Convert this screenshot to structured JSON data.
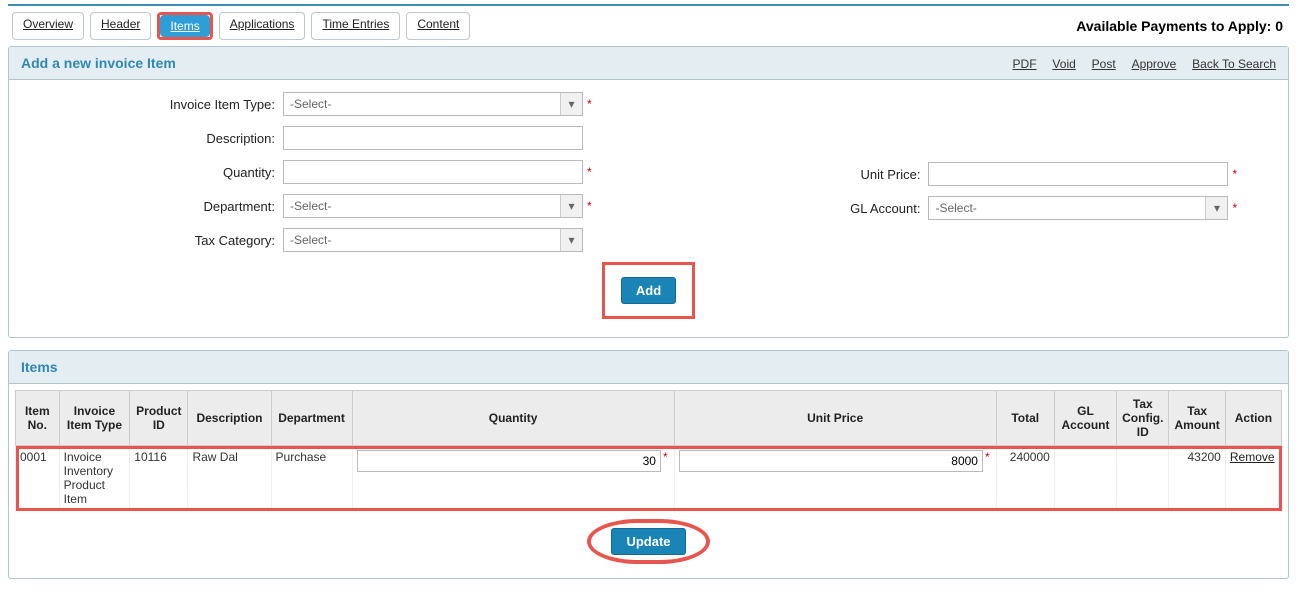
{
  "availablePayments": "Available Payments to Apply: 0",
  "tabs": {
    "overview": "Overview",
    "header": "Header",
    "items": "Items",
    "applications": "Applications",
    "timeEntries": "Time Entries",
    "content": "Content"
  },
  "addPanel": {
    "title": "Add a new invoice Item",
    "actions": {
      "pdf": "PDF",
      "void": "Void",
      "post": "Post",
      "approve": "Approve",
      "back": "Back To Search"
    },
    "labels": {
      "invoiceItemType": "Invoice Item Type:",
      "description": "Description:",
      "quantity": "Quantity:",
      "department": "Department:",
      "taxCategory": "Tax Category:",
      "unitPrice": "Unit Price:",
      "glAccount": "GL Account:"
    },
    "selectPlaceholder": "-Select-",
    "addLabel": "Add"
  },
  "itemsPanel": {
    "title": "Items",
    "headers": {
      "itemNo": "Item No.",
      "invoiceItemType": "Invoice Item Type",
      "productId": "Product ID",
      "description": "Description",
      "department": "Department",
      "quantity": "Quantity",
      "unitPrice": "Unit Price",
      "total": "Total",
      "glAccount": "GL Account",
      "taxConfigId": "Tax Config. ID",
      "taxAmount": "Tax Amount",
      "action": "Action"
    },
    "rows": [
      {
        "itemNo": "0001",
        "invoiceItemType": "Invoice Inventory Product Item",
        "productId": "10116",
        "description": "Raw Dal",
        "department": "Purchase",
        "quantity": "30",
        "unitPrice": "8000",
        "total": "240000",
        "glAccount": "",
        "taxConfigId": "",
        "taxAmount": "43200",
        "action": "Remove"
      }
    ],
    "updateLabel": "Update"
  }
}
